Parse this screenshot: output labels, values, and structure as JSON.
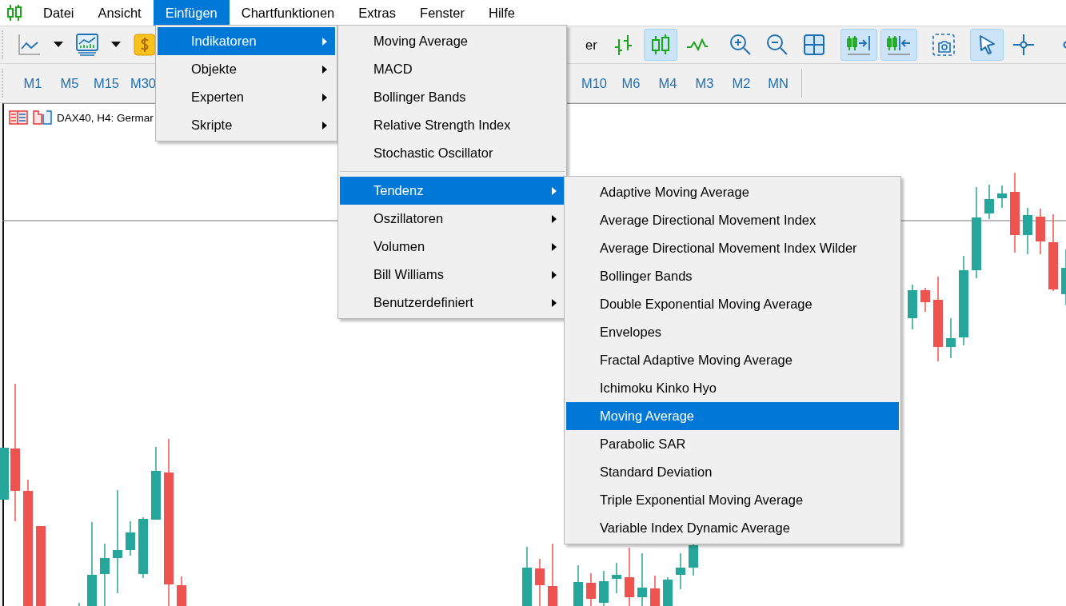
{
  "menu_bar": {
    "items": [
      {
        "label": "Datei",
        "selected": false
      },
      {
        "label": "Ansicht",
        "selected": false
      },
      {
        "label": "Einfügen",
        "selected": true
      },
      {
        "label": "Chartfunktionen",
        "selected": false
      },
      {
        "label": "Extras",
        "selected": false
      },
      {
        "label": "Fenster",
        "selected": false
      },
      {
        "label": "Hilfe",
        "selected": false
      }
    ]
  },
  "toolbar": {
    "left_groups": [
      [
        {
          "kind": "line-chart",
          "selected": false
        },
        {
          "kind": "caret",
          "selected": false
        },
        {
          "kind": "monitor-chart",
          "selected": false
        },
        {
          "kind": "caret",
          "selected": false
        },
        {
          "kind": "dollar",
          "selected": false
        }
      ]
    ],
    "partial_label": "er",
    "right_groups": [
      [
        {
          "kind": "bar-chart",
          "selected": false
        },
        {
          "kind": "candles",
          "selected": true
        },
        {
          "kind": "line",
          "selected": false
        }
      ],
      [
        {
          "kind": "zoom-in",
          "selected": false
        },
        {
          "kind": "zoom-out",
          "selected": false
        },
        {
          "kind": "tile",
          "selected": false
        }
      ],
      [
        {
          "kind": "scroll",
          "selected": true
        },
        {
          "kind": "shift",
          "selected": true
        }
      ],
      [
        {
          "kind": "screenshot",
          "selected": false
        }
      ],
      [
        {
          "kind": "cursor",
          "selected": true
        },
        {
          "kind": "crosshair",
          "selected": false
        }
      ],
      [
        {
          "kind": "vline",
          "selected": false
        }
      ]
    ]
  },
  "timeframe_bar": {
    "groups": [
      [
        {
          "label": "M1"
        },
        {
          "label": "M5"
        },
        {
          "label": "M15"
        },
        {
          "label": "M30"
        }
      ],
      [
        {
          "label": "M10"
        },
        {
          "label": "M6"
        },
        {
          "label": "M4"
        },
        {
          "label": "M3"
        },
        {
          "label": "M2"
        },
        {
          "label": "MN"
        }
      ]
    ]
  },
  "chart": {
    "title": "DAX40, H4:  Germar"
  },
  "menus": [
    {
      "items": [
        {
          "kind": "item",
          "label": "Indikatoren",
          "submenu": true,
          "selected": true
        },
        {
          "kind": "item",
          "label": "Objekte",
          "submenu": true,
          "selected": false
        },
        {
          "kind": "item",
          "label": "Experten",
          "submenu": true,
          "selected": false
        },
        {
          "kind": "item",
          "label": "Skripte",
          "submenu": true,
          "selected": false
        }
      ]
    },
    {
      "items": [
        {
          "kind": "item",
          "label": "Moving Average",
          "submenu": false,
          "selected": false
        },
        {
          "kind": "item",
          "label": "MACD",
          "submenu": false,
          "selected": false
        },
        {
          "kind": "item",
          "label": "Bollinger Bands",
          "submenu": false,
          "selected": false
        },
        {
          "kind": "item",
          "label": "Relative Strength Index",
          "submenu": false,
          "selected": false
        },
        {
          "kind": "item",
          "label": "Stochastic Oscillator",
          "submenu": false,
          "selected": false
        },
        {
          "kind": "separator"
        },
        {
          "kind": "item",
          "label": "Tendenz",
          "submenu": true,
          "selected": true
        },
        {
          "kind": "item",
          "label": "Oszillatoren",
          "submenu": true,
          "selected": false
        },
        {
          "kind": "item",
          "label": "Volumen",
          "submenu": true,
          "selected": false
        },
        {
          "kind": "item",
          "label": "Bill Williams",
          "submenu": true,
          "selected": false
        },
        {
          "kind": "item",
          "label": "Benutzerdefiniert",
          "submenu": true,
          "selected": false
        }
      ]
    },
    {
      "items": [
        {
          "kind": "item",
          "label": "Adaptive Moving Average",
          "submenu": false,
          "selected": false
        },
        {
          "kind": "item",
          "label": "Average Directional Movement Index",
          "submenu": false,
          "selected": false
        },
        {
          "kind": "item",
          "label": "Average Directional Movement Index Wilder",
          "submenu": false,
          "selected": false
        },
        {
          "kind": "item",
          "label": "Bollinger Bands",
          "submenu": false,
          "selected": false
        },
        {
          "kind": "item",
          "label": "Double Exponential Moving Average",
          "submenu": false,
          "selected": false
        },
        {
          "kind": "item",
          "label": "Envelopes",
          "submenu": false,
          "selected": false
        },
        {
          "kind": "item",
          "label": "Fractal Adaptive Moving Average",
          "submenu": false,
          "selected": false
        },
        {
          "kind": "item",
          "label": "Ichimoku Kinko Hyo",
          "submenu": false,
          "selected": false
        },
        {
          "kind": "item",
          "label": "Moving Average",
          "submenu": false,
          "selected": true
        },
        {
          "kind": "item",
          "label": "Parabolic SAR",
          "submenu": false,
          "selected": false
        },
        {
          "kind": "item",
          "label": "Standard Deviation",
          "submenu": false,
          "selected": false
        },
        {
          "kind": "item",
          "label": "Triple Exponential Moving Average",
          "submenu": false,
          "selected": false
        },
        {
          "kind": "item",
          "label": "Variable Index Dynamic Average",
          "submenu": false,
          "selected": false
        }
      ]
    }
  ]
}
